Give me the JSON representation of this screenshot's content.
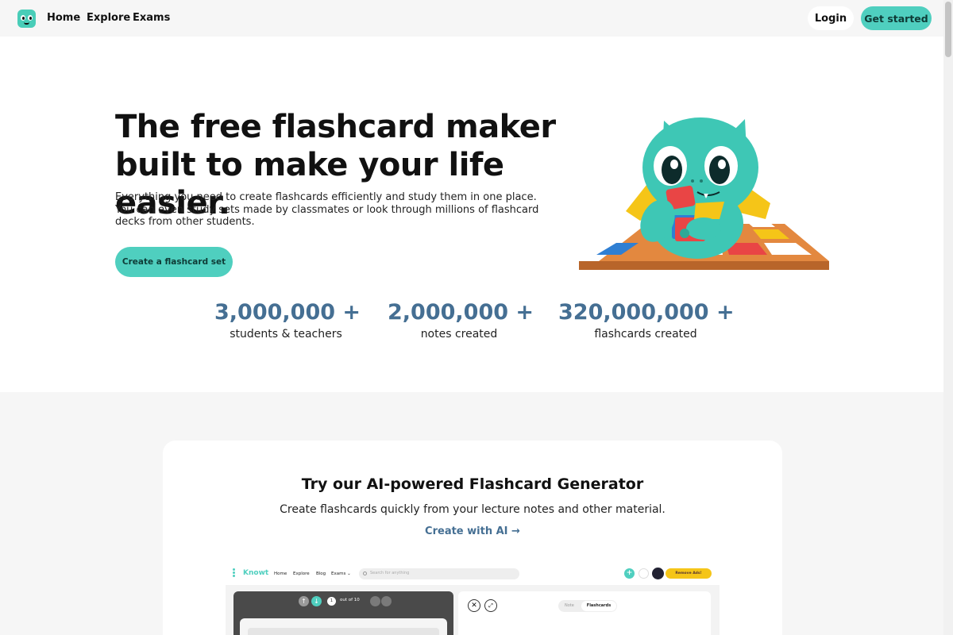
{
  "nav": {
    "links": [
      "Home",
      "Explore",
      "Exams"
    ],
    "login": "Login",
    "get_started": "Get started"
  },
  "hero": {
    "title_line1": "The free flashcard maker",
    "title_line2": "built to make your life easier.",
    "description": "Everything you need to create flashcards efficiently and study them in one place. You can even study sets made by classmates or look through millions of flashcard decks from other students.",
    "cta": "Create a flashcard set"
  },
  "stats": [
    {
      "value": "3,000,000 +",
      "label": "students & teachers"
    },
    {
      "value": "2,000,000 +",
      "label": "notes created"
    },
    {
      "value": "320,000,000 +",
      "label": "flashcards created"
    }
  ],
  "ai_section": {
    "title": "Try our AI-powered Flashcard Generator",
    "subtitle": "Create flashcards quickly from your lecture notes and other material.",
    "link": "Create with AI →"
  },
  "preview": {
    "brand": "Knowt",
    "nav": [
      "Home",
      "Explore",
      "Blog",
      "Exams ⌄"
    ],
    "search_placeholder": "Search for anything",
    "plus": "+",
    "cta": "Remove Ads!",
    "page": "1",
    "out_of": "out of 10",
    "tab_note": "Note",
    "tab_flashcards": "Flashcards",
    "close": "✕",
    "expand": "⤢",
    "arrow_up": "↑",
    "arrow_down": "↓"
  },
  "colors": {
    "accent": "#4fcfbf",
    "stat": "#456f93"
  }
}
